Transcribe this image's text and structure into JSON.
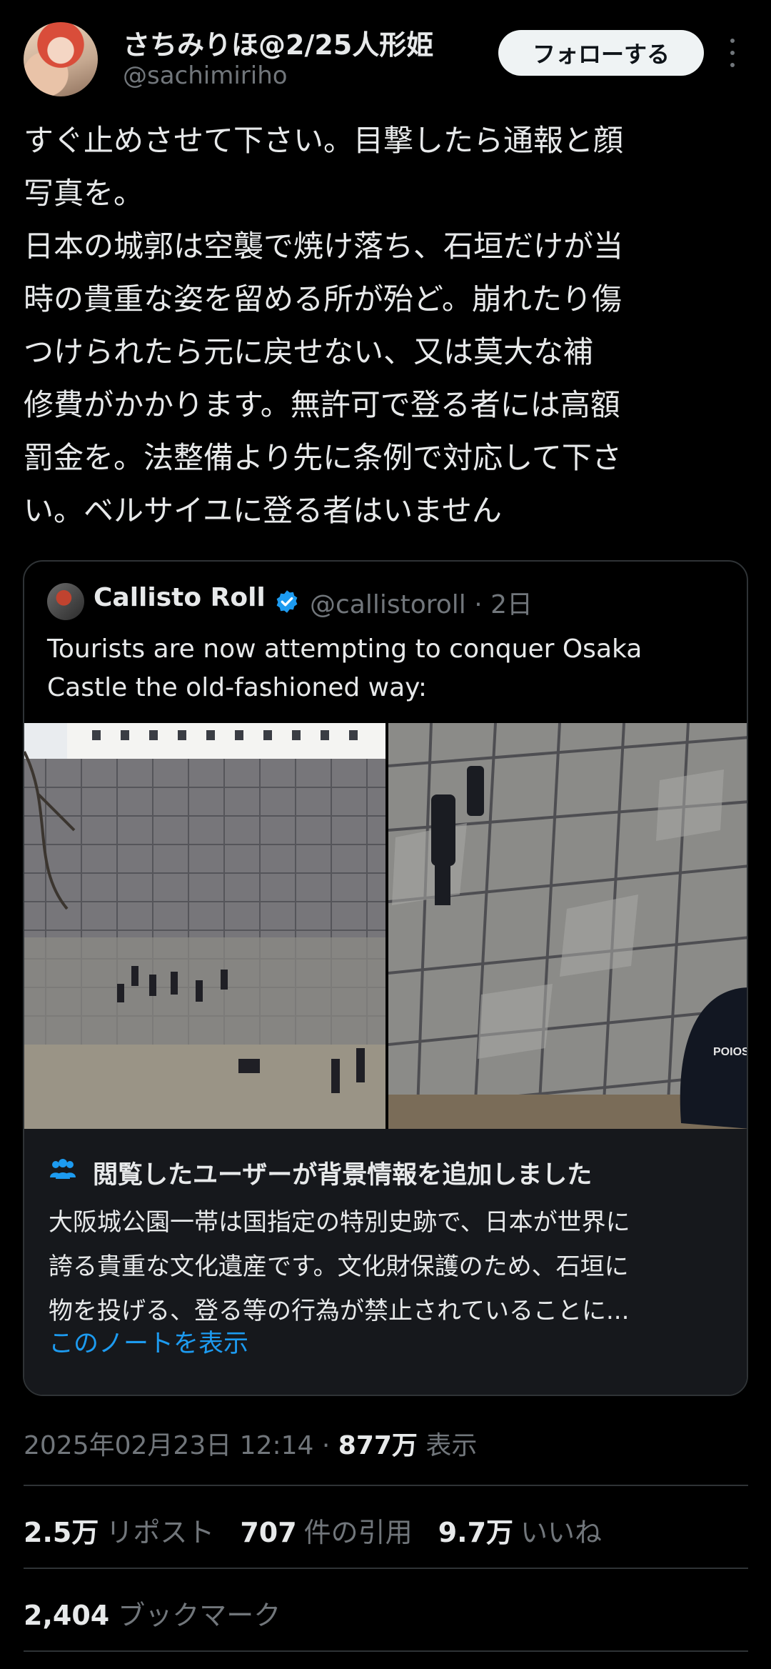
{
  "author": {
    "display_name": "さちみりほ@2/25人形姫",
    "handle": "@sachimiriho",
    "follow_label": "フォローする"
  },
  "tweet": {
    "lines": [
      "すぐ止めさせて下さい。目撃したら通報と顔",
      "写真を。",
      "日本の城郭は空襲で焼け落ち、石垣だけが当",
      "時の貴重な姿を留める所が殆ど。崩れたり傷",
      "つけられたら元に戻せない、又は莫大な補",
      "修費がかかります。無許可で登る者には高額",
      "罰金を。法整備より先に条例で対応して下さ",
      "い。ベルサイユに登る者はいません"
    ]
  },
  "quote": {
    "name": "Callisto Roll",
    "handle_time": "@callistoroll · 2日",
    "text_lines": [
      "Tourists are now attempting to conquer Osaka",
      "Castle the old-fashioned way:"
    ],
    "photo_right_badge": "POIOS"
  },
  "community_note": {
    "title": "閲覧したユーザーが背景情報を追加しました",
    "body_lines": [
      "大阪城公園一帯は国指定の特別史跡で、日本が世界に",
      "誇る貴重な文化遺産です。文化財保護のため、石垣に",
      "物を投げる、登る等の行為が禁止されていることに..."
    ],
    "link": "このノートを表示"
  },
  "meta": {
    "datetime": "2025年02月23日 12:14 · ",
    "views_count": "877万",
    "views_label": " 表示"
  },
  "stats": {
    "reposts_count": "2.5万",
    "reposts_label": "リポスト",
    "quotes_count": "707",
    "quotes_label": "件の引用",
    "likes_count": "9.7万",
    "likes_label": "いいね",
    "bookmarks_count": "2,404",
    "bookmarks_label": "ブックマーク"
  },
  "colors": {
    "background": "#000000",
    "text": "#e7e9ea",
    "muted": "#71767b",
    "link": "#1d9bf0",
    "verified": "#1d9bf0"
  }
}
